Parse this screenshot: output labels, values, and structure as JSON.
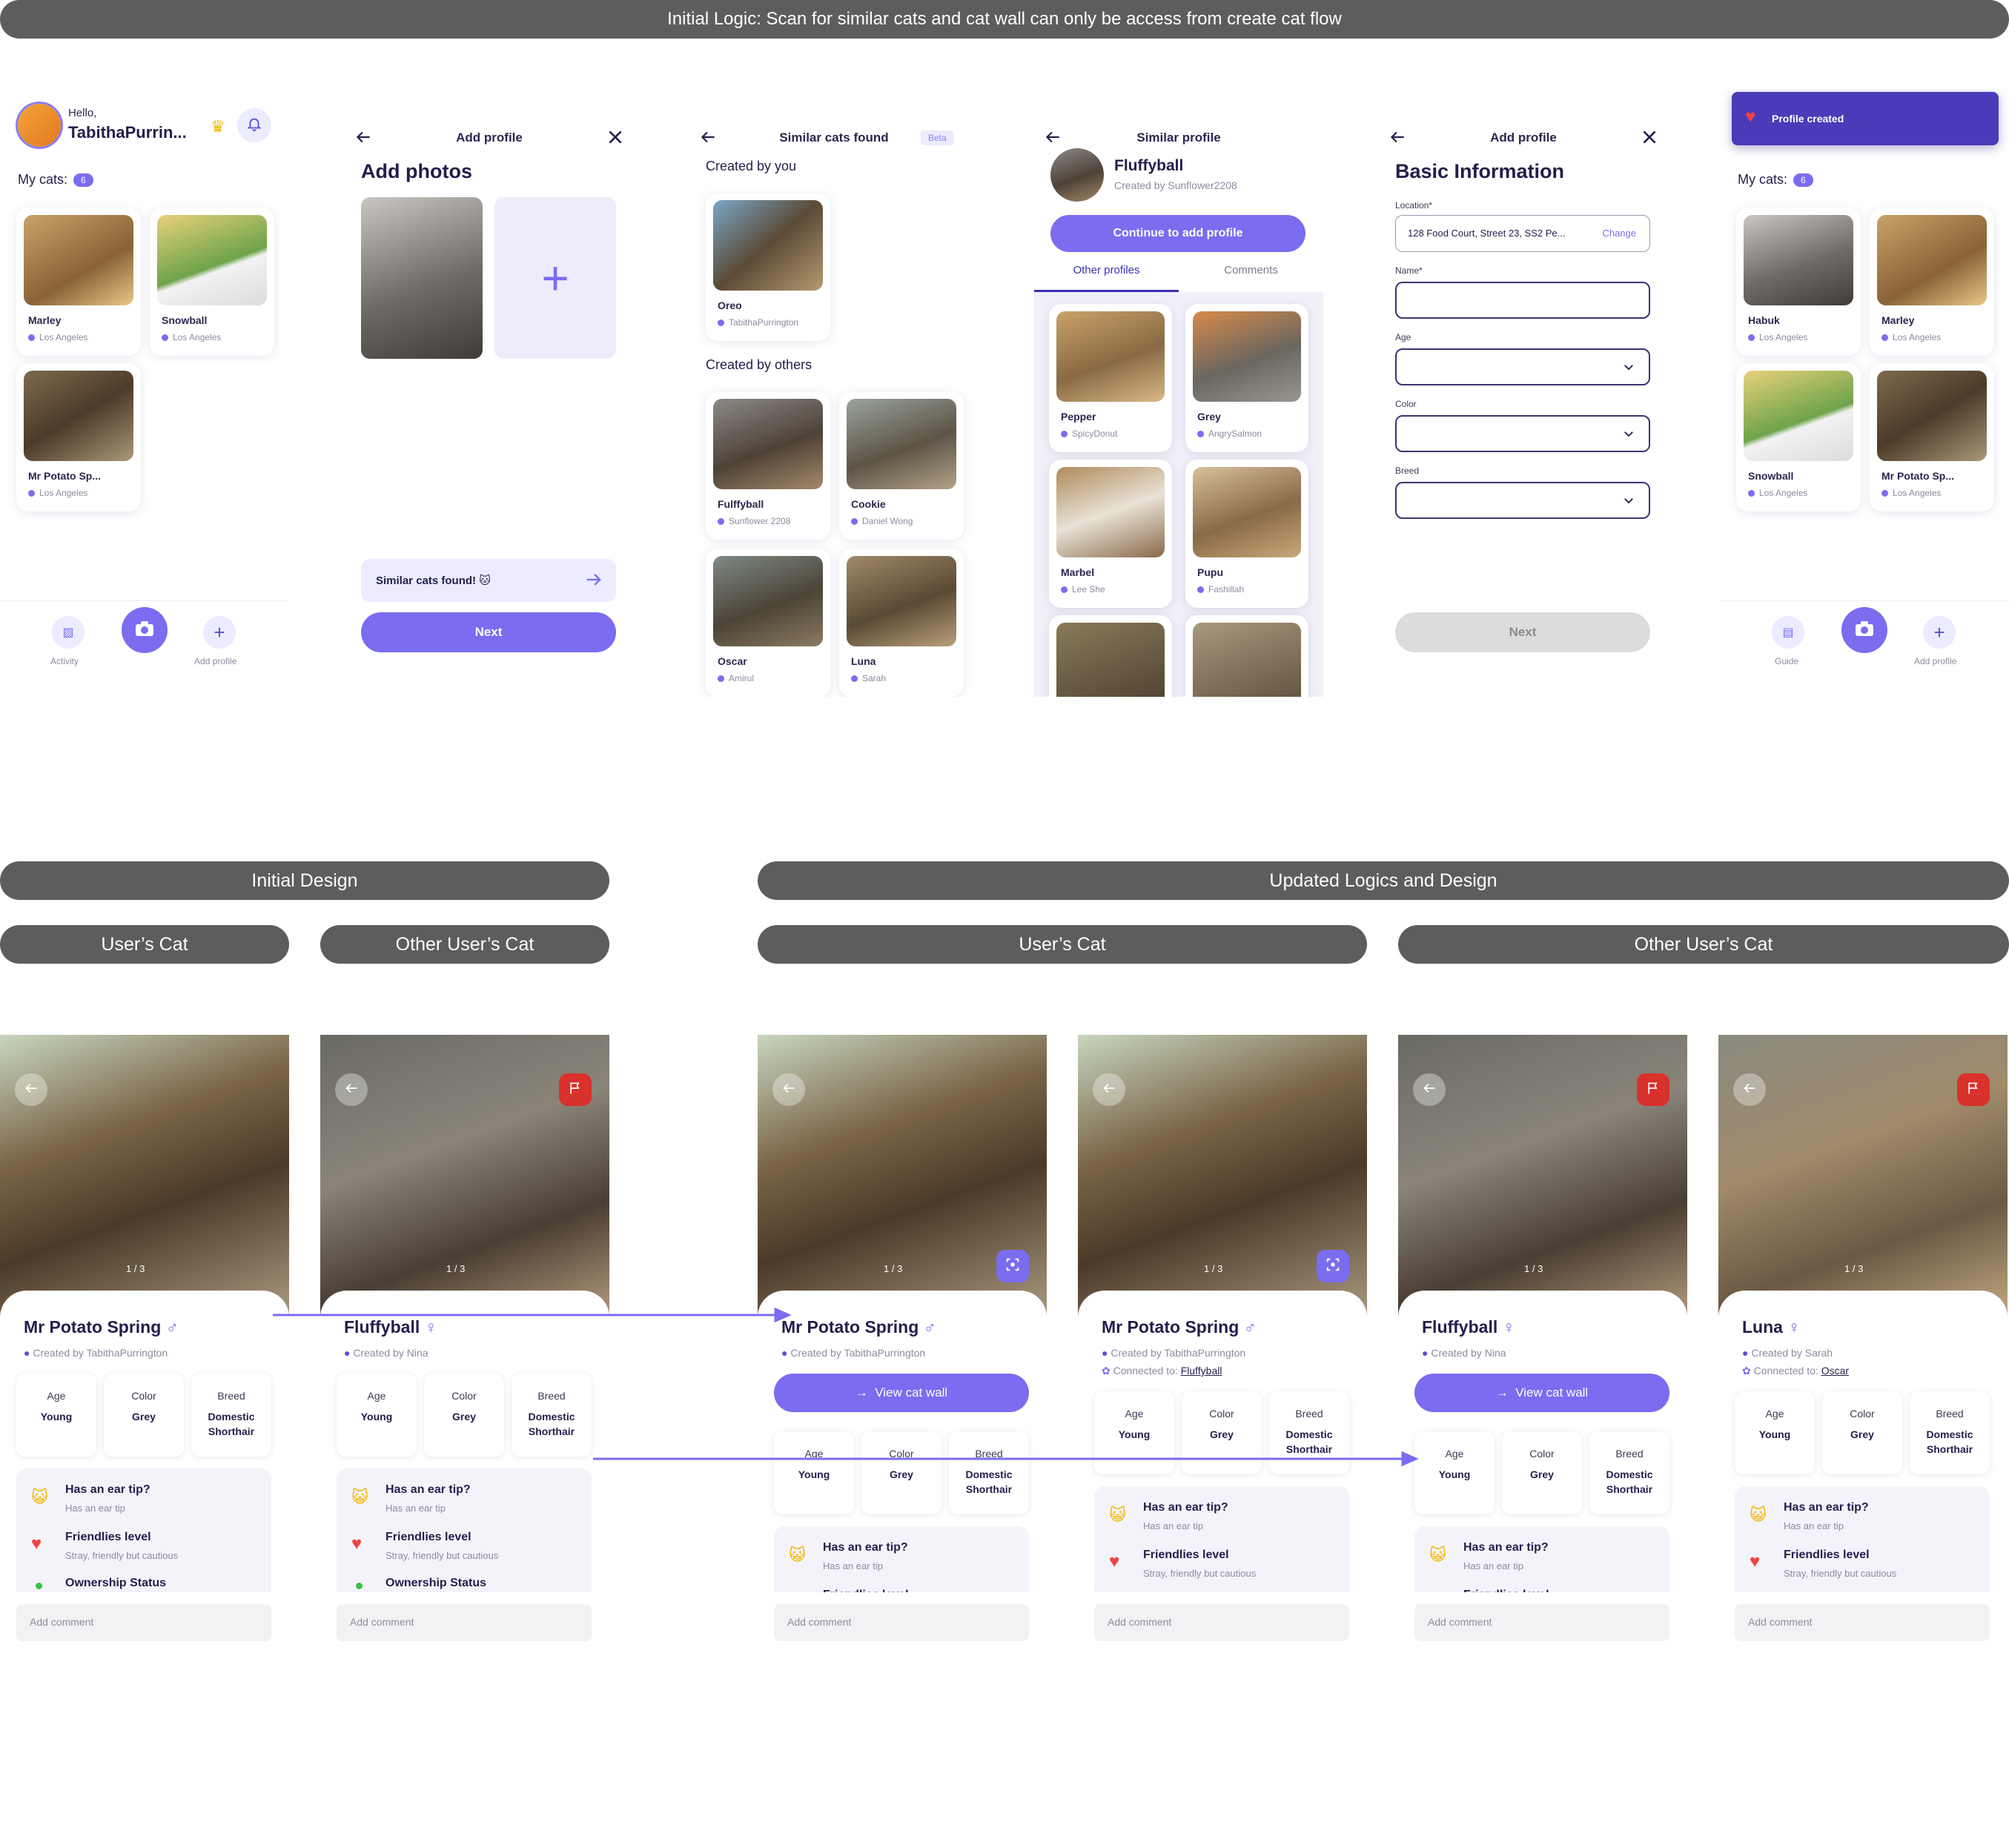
{
  "banner": {
    "title": "Initial Logic: Scan for similar cats and cat wall can only be access from create cat flow"
  },
  "colors": {
    "accent": "#7b6cf0",
    "dark": "#221e4b",
    "banner": "#5d5d5d",
    "toast": "#4a3bb8",
    "flag": "#d9312b"
  },
  "home": {
    "hello": "Hello,",
    "user": "TabithaPurrin...",
    "my_cats": "My cats:",
    "count": "6",
    "cats": [
      {
        "name": "Marley",
        "loc": "Los Angeles"
      },
      {
        "name": "Snowball",
        "loc": "Los Angeles"
      },
      {
        "name": "Mr Potato Sp...",
        "loc": "Los Angeles"
      }
    ],
    "nav": {
      "activity": "Activity",
      "add": "Add profile"
    }
  },
  "add_photos": {
    "nav_title": "Add profile",
    "heading": "Add photos",
    "similar": "Similar cats found! 🐱",
    "next": "Next"
  },
  "similar": {
    "nav_title": "Similar cats found",
    "beta": "Beta",
    "by_you": "Created by you",
    "by_others": "Created by others",
    "you": [
      {
        "name": "Oreo",
        "owner": "TabithaPurrington"
      }
    ],
    "others": [
      {
        "name": "Fulffyball",
        "owner": "Sunflower 2208"
      },
      {
        "name": "Cookie",
        "owner": "Daniel Wong"
      },
      {
        "name": "Oscar",
        "owner": "Amirul"
      },
      {
        "name": "Luna",
        "owner": "Sarah"
      }
    ]
  },
  "similar_profile": {
    "nav_title": "Similar profile",
    "name": "Fluffyball",
    "created": "Created by Sunflower2208",
    "cta": "Continue to add profile",
    "tab1": "Other profiles",
    "tab2": "Comments",
    "profiles": [
      {
        "name": "Pepper",
        "owner": "SpicyDonut"
      },
      {
        "name": "Grey",
        "owner": "AngrySalmon"
      },
      {
        "name": "Marbel",
        "owner": "Lee She"
      },
      {
        "name": "Pupu",
        "owner": "Fashillah"
      }
    ]
  },
  "basic": {
    "nav_title": "Add profile",
    "heading": "Basic Information",
    "location_label": "Location*",
    "location": "128 Food Court, Street 23, SS2 Pe...",
    "change": "Change",
    "name_label": "Name*",
    "age_label": "Age",
    "color_label": "Color",
    "breed_label": "Breed",
    "next": "Next"
  },
  "created": {
    "toast": "Profile created",
    "my_cats": "My cats:",
    "count": "6",
    "cats": [
      {
        "name": "Habuk",
        "loc": "Los Angeles"
      },
      {
        "name": "Marley",
        "loc": "Los Angeles"
      },
      {
        "name": "Snowball",
        "loc": "Los Angeles"
      },
      {
        "name": "Mr Potato Sp...",
        "loc": "Los Angeles"
      }
    ],
    "nav": {
      "guide": "Guide",
      "add": "Add profile"
    }
  },
  "sections": {
    "initial": "Initial Design",
    "updated": "Updated Logics and Design",
    "users_cat": "User’s Cat",
    "other_cat": "Other User’s Cat"
  },
  "labels": {
    "age": "Age",
    "color": "Color",
    "breed": "Breed",
    "ear": "Has an ear tip?",
    "ear_sub": "Has an ear tip",
    "friendly": "Friendlies level",
    "friendly_sub": "Stray, friendly but cautious",
    "ownership": "Ownership Status",
    "comment": "Add comment",
    "wall": "View cat wall",
    "pager": "1 / 3",
    "connected": "Connected to:"
  },
  "details": [
    {
      "name": "Mr Potato Spring",
      "sex": "♂",
      "created": "Created by TabithaPurrington",
      "age": "Young",
      "color": "Grey",
      "breed": "Domestic Shorthair"
    },
    {
      "name": "Fluffyball",
      "sex": "♀",
      "created": "Created by Nina",
      "age": "Young",
      "color": "Grey",
      "breed": "Domestic Shorthair"
    },
    {
      "name": "Mr Potato Spring",
      "sex": "♂",
      "created": "Created by TabithaPurrington",
      "age": "Young",
      "color": "Grey",
      "breed": "Domestic Shorthair"
    },
    {
      "name": "Mr Potato Spring",
      "sex": "♂",
      "created": "Created by TabithaPurrington",
      "connected": "Fluffyball",
      "age": "Young",
      "color": "Grey",
      "breed": "Domestic Shorthair"
    },
    {
      "name": "Fluffyball",
      "sex": "♀",
      "created": "Created by Nina",
      "age": "Young",
      "color": "Grey",
      "breed": "Domestic Shorthair"
    },
    {
      "name": "Luna",
      "sex": "♀",
      "created": "Created by Sarah",
      "connected": "Oscar",
      "age": "Young",
      "color": "Grey",
      "breed": "Domestic Shorthair"
    }
  ]
}
